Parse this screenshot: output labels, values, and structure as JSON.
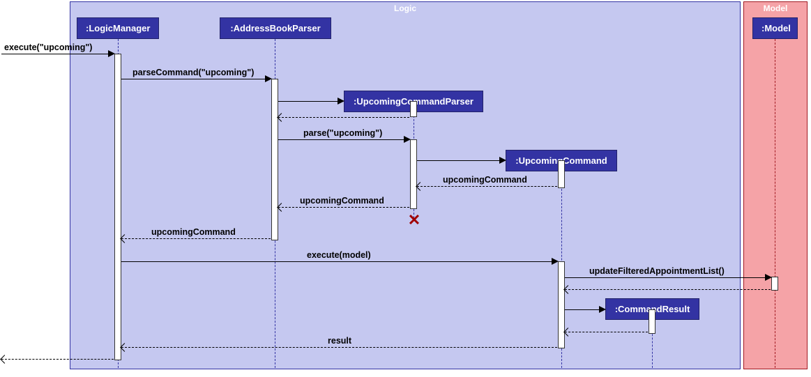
{
  "boxes": {
    "logic": {
      "title": "Logic",
      "color": "#3333a3",
      "bg": "#c5c8f0"
    },
    "model": {
      "title": "Model",
      "color": "#a01820",
      "bg": "#f5a3a7"
    }
  },
  "participants": {
    "logicManager": ":LogicManager",
    "addressBookParser": ":AddressBookParser",
    "upcomingCommandParser": ":UpcomingCommandParser",
    "upcomingCommand": ":UpcomingCommand",
    "commandResult": ":CommandResult",
    "model": ":Model"
  },
  "messages": {
    "execute1": "execute(\"upcoming\")",
    "parseCommand": "parseCommand(\"upcoming\")",
    "parse": "parse(\"upcoming\")",
    "upcomingCommandReturn1": "upcomingCommand",
    "upcomingCommandReturn2": "upcomingCommand",
    "upcomingCommandReturn3": "upcomingCommand",
    "executeModel": "execute(model)",
    "updateFiltered": "updateFilteredAppointmentList()",
    "result": "result"
  }
}
